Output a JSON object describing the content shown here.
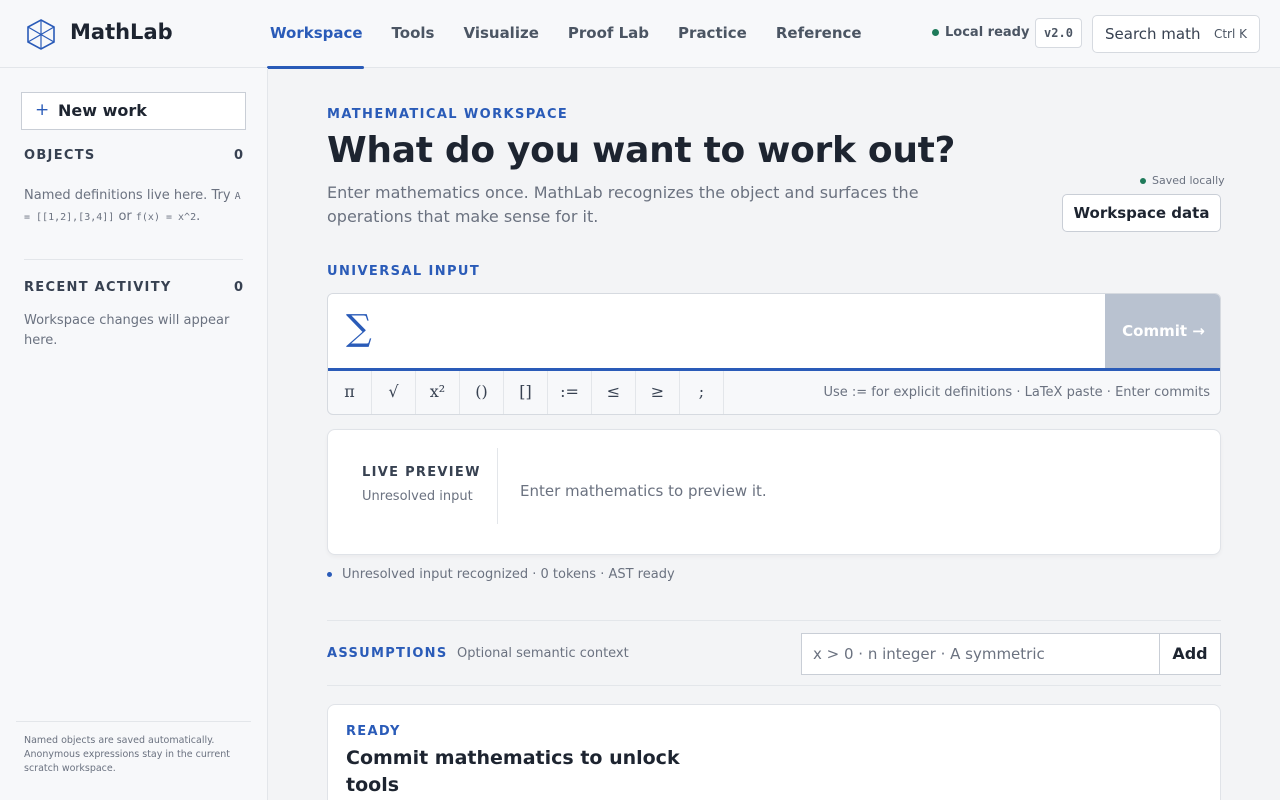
{
  "header": {
    "brand": "MathLab",
    "nav": [
      "Workspace",
      "Tools",
      "Visualize",
      "Proof Lab",
      "Practice",
      "Reference"
    ],
    "active_nav": "Workspace",
    "status": "Local ready",
    "version": "v2.0",
    "search_label": "Search math",
    "search_shortcut": "Ctrl K"
  },
  "sidebar": {
    "new_work": "New work",
    "objects": {
      "heading": "OBJECTS",
      "count": "0",
      "text_before": "Named definitions live here. Try ",
      "example1": "A = [[1,2],[3,4]]",
      "text_or": " or ",
      "example2": "f(x) = x^2",
      "text_after": "."
    },
    "recent": {
      "heading": "RECENT ACTIVITY",
      "count": "0",
      "text": "Workspace changes will appear here."
    },
    "footer": "Named objects are saved automatically. Anonymous expressions stay in the current scratch workspace."
  },
  "main": {
    "eyebrow": "MATHEMATICAL WORKSPACE",
    "title": "What do you want to work out?",
    "subtitle": "Enter mathematics once. MathLab recognizes the object and surfaces the operations that make sense for it.",
    "saved_status": "Saved locally",
    "workspace_data_button": "Workspace data",
    "input_heading": "UNIVERSAL INPUT",
    "input_glyph": "∑",
    "input_value": "",
    "commit_label": "Commit  →",
    "symbols": [
      "π",
      "√",
      "x²",
      "()",
      "[]",
      ":=",
      "≤",
      "≥",
      ";"
    ],
    "symbol_hint": "Use := for explicit definitions · LaTeX paste · Enter commits",
    "preview": {
      "heading": "LIVE PREVIEW",
      "subheading": "Unresolved input",
      "message": "Enter mathematics to preview it."
    },
    "recognition": "Unresolved input recognized · 0 tokens · AST ready",
    "assumptions": {
      "heading": "ASSUMPTIONS",
      "subheading": "Optional semantic context",
      "placeholder": "x > 0 · n integer · A symmetric",
      "add_label": "Add"
    },
    "ready": {
      "heading": "READY",
      "title": "Commit mathematics to unlock tools"
    }
  },
  "colors": {
    "accent": "#2a5bb8",
    "status_green": "#1f7a5a",
    "commit_disabled": "#b9c2d0"
  },
  "icons": {
    "logo": "cube-logo-icon",
    "new_work": "plus-icon",
    "input": "sigma-icon",
    "commit": "arrow-right-icon"
  }
}
